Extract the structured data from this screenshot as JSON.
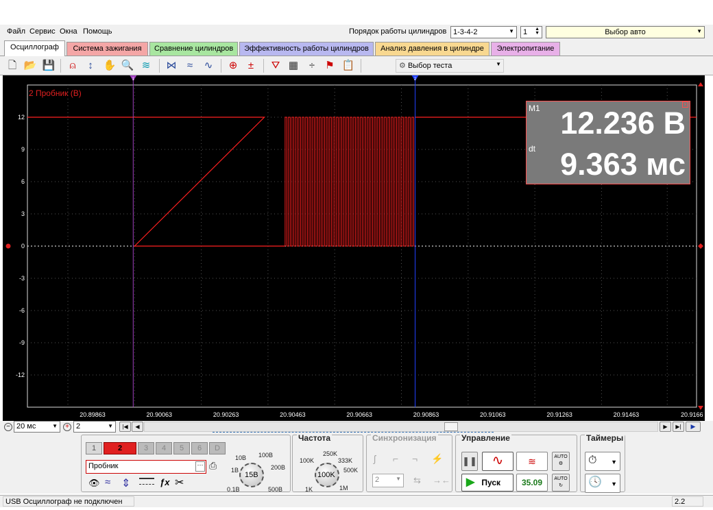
{
  "menu": {
    "file": "Файл",
    "service": "Сервис",
    "windows": "Окна",
    "help": "Помощь"
  },
  "header": {
    "firing_order_label": "Порядок работы цилиндров",
    "firing_order_value": "1-3-4-2",
    "cylinder_value": "1",
    "car_select": "Выбор авто"
  },
  "tabs": [
    {
      "label": "Осциллограф",
      "color": "#ffffff"
    },
    {
      "label": "Система зажигания",
      "color": "#f4a6a6"
    },
    {
      "label": "Сравнение цилиндров",
      "color": "#a8e6a0"
    },
    {
      "label": "Эффективность работы цилиндров",
      "color": "#b8b8f0"
    },
    {
      "label": "Анализ давления в цилиндре",
      "color": "#f8d890"
    },
    {
      "label": "Электропитание",
      "color": "#e8b0e8"
    }
  ],
  "toolbar": {
    "test_select": "Выбор теста"
  },
  "scope": {
    "channel_label": "2 Пробник (В)",
    "y_ticks": [
      "12",
      "9",
      "6",
      "3",
      "0",
      "-3",
      "-6",
      "-9",
      "-12"
    ],
    "x_ticks": [
      "20.89863",
      "20.90063",
      "20.90263",
      "20.90463",
      "20.90663",
      "20.90863",
      "20.91063",
      "20.91263",
      "20.91463",
      "20.9166"
    ],
    "cursor1_label": "1",
    "cursor2_label": "2",
    "trace_color": "#ff2020",
    "signal": {
      "high_v": 12,
      "low_v": 0,
      "fall_t": 20.90063,
      "burst_start_t": 20.90463,
      "burst_end_t": 20.90863,
      "rise_t": 20.90863
    }
  },
  "measurement": {
    "marker": "M1",
    "value": "12.236 В",
    "dt_label": "dt",
    "dt_value": "9.363 мс"
  },
  "nav": {
    "timebase": "20 мс",
    "zoom": "2"
  },
  "controls": {
    "channels": [
      "1",
      "2",
      "3",
      "4",
      "5",
      "6",
      "D"
    ],
    "probe": "Пробник",
    "voltage": {
      "knob_value": "15В",
      "labels": [
        "10В",
        "100В",
        "1В",
        "200В",
        "0.1В",
        "500В"
      ]
    },
    "freq": {
      "title": "Частота",
      "knob_value": "100K",
      "labels": [
        "250K",
        "100K",
        "333K",
        "500K",
        "1K",
        "1M"
      ]
    },
    "sync": {
      "title": "Синхронизация",
      "value": "2"
    },
    "control": {
      "title": "Управление",
      "start": "Пуск",
      "fps": "35.09",
      "auto": "AUTO"
    },
    "timers": {
      "title": "Таймеры"
    }
  },
  "status": {
    "text": "USB Осциллограф не подключен",
    "version": "2.2"
  }
}
